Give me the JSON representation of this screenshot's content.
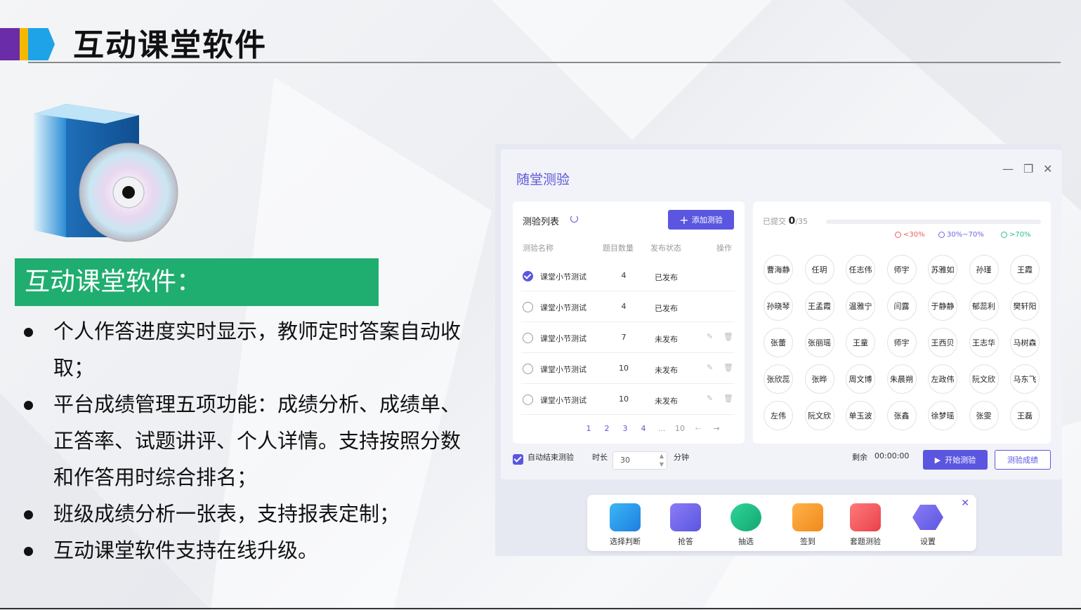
{
  "slide": {
    "title": "互动课堂软件",
    "section_title": "互动课堂软件：",
    "bullets": [
      "个人作答进度实时显示，教师定时答案自动收取；",
      "平台成绩管理五项功能：成绩分析、成绩单、正答率、试题讲评、个人详情。支持按照分数和作答用时综合排名；",
      "班级成绩分析一张表，支持报表定制；",
      "互动课堂软件支持在线升级。"
    ],
    "colors": {
      "bar1": "#6a2ca8",
      "bar2": "#f5b800",
      "bar3": "#1fa3e8",
      "green": "#1fae6f"
    }
  },
  "app": {
    "title": "随堂测验",
    "list": {
      "title": "测验列表",
      "add_label": "添加测验",
      "headers": {
        "name": "测验名称",
        "count": "题目数量",
        "status": "发布状态",
        "op": "操作"
      },
      "rows": [
        {
          "name": "课堂小节测试",
          "count": "4",
          "status": "已发布",
          "checked": true
        },
        {
          "name": "课堂小节测试",
          "count": "4",
          "status": "已发布",
          "checked": false
        },
        {
          "name": "课堂小节测试",
          "count": "7",
          "status": "未发布",
          "checked": false
        },
        {
          "name": "课堂小节测试",
          "count": "10",
          "status": "未发布",
          "checked": false
        },
        {
          "name": "课堂小节测试",
          "count": "10",
          "status": "未发布",
          "checked": false
        }
      ],
      "pager": [
        "1",
        "2",
        "3",
        "4",
        "...",
        "10"
      ]
    },
    "submit": {
      "label": "已提交",
      "count": "0",
      "total": "/35",
      "legend": [
        "<30%",
        "30%~70%",
        ">70%"
      ]
    },
    "students": [
      "曹海静",
      "任玥",
      "任志伟",
      "师宇",
      "苏雅如",
      "孙瑾",
      "王霞",
      "孙晓琴",
      "王孟霞",
      "温雅宁",
      "闫露",
      "于静静",
      "郁蕊利",
      "樊轩阳",
      "张蕾",
      "张丽瑶",
      "王童",
      "师宇",
      "王西贝",
      "王志华",
      "马树森",
      "张欣蕊",
      "张晔",
      "周文博",
      "朱晨朔",
      "左政伟",
      "阮文欣",
      "马东飞",
      "左伟",
      "阮文欣",
      "单玉波",
      "张鑫",
      "徐梦瑶",
      "张雯",
      "王磊"
    ],
    "footer": {
      "auto_end": "自动结束测验",
      "duration_label": "时长",
      "duration_value": "30",
      "unit": "分钟",
      "remaining_label": "剩余",
      "remaining_value": "00:00:00",
      "start_label": "开始测验",
      "score_label": "测验成绩"
    },
    "toolbar": [
      "选择判断",
      "抢答",
      "抽选",
      "签到",
      "套题测验",
      "设置"
    ]
  }
}
